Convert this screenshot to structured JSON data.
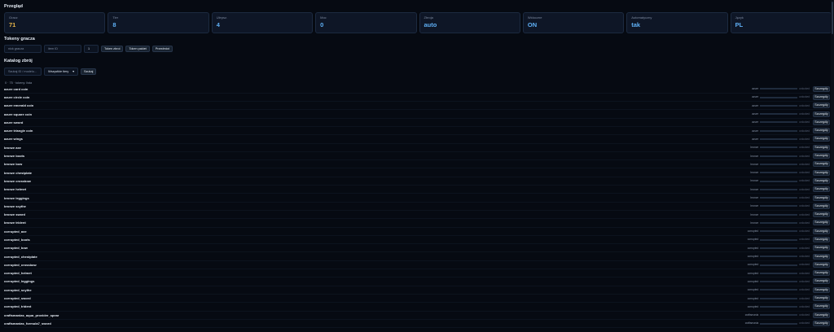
{
  "overview": {
    "title": "Przegląd",
    "cards": [
      {
        "label": "Gracz",
        "value": "71",
        "gold": true
      },
      {
        "label": "Tier",
        "value": "8"
      },
      {
        "label": "Ulepsz.",
        "value": "4"
      },
      {
        "label": "Moc",
        "value": "0"
      },
      {
        "label": "Zbroja",
        "value": "auto"
      },
      {
        "label": "Widoczne",
        "value": "ON"
      },
      {
        "label": "Automatyczny",
        "value": "tak"
      },
      {
        "label": "Język",
        "value": "PL"
      }
    ]
  },
  "tokens": {
    "title": "Tokeny gracza",
    "player_placeholder": "nick gracza",
    "item_placeholder": "item ID",
    "amount_value": "1",
    "buttons": [
      "Token zbroi",
      "Token pakiet",
      "Przedmiot"
    ]
  },
  "catalog": {
    "title": "Katalog zbrój",
    "search_placeholder": "Szukaj ID / modelu...",
    "filter_value": "Wszystkie tiery",
    "filter_chevron": "▾",
    "filter_button": "Szukaj",
    "meta_text": "0 · 75 · tokeny: lista",
    "give_label": "Szczegóły",
    "items": [
      {
        "name": "azure card coin",
        "tier": "azure"
      },
      {
        "name": "azure circle coin",
        "tier": "azure"
      },
      {
        "name": "azure emerald coin",
        "tier": "azure"
      },
      {
        "name": "azure square coin",
        "tier": "azure"
      },
      {
        "name": "azure sword",
        "tier": "azure"
      },
      {
        "name": "azure triangle coin",
        "tier": "azure"
      },
      {
        "name": "azure wings",
        "tier": "azure"
      },
      {
        "name": "bronze axe",
        "tier": "bronze"
      },
      {
        "name": "bronze boots",
        "tier": "bronze"
      },
      {
        "name": "bronze bow",
        "tier": "bronze"
      },
      {
        "name": "bronze chestplate",
        "tier": "bronze"
      },
      {
        "name": "bronze crossbow",
        "tier": "bronze"
      },
      {
        "name": "bronze helmet",
        "tier": "bronze"
      },
      {
        "name": "bronze leggings",
        "tier": "bronze"
      },
      {
        "name": "bronze scythe",
        "tier": "bronze"
      },
      {
        "name": "bronze sword",
        "tier": "bronze"
      },
      {
        "name": "bronze trident",
        "tier": "bronze"
      },
      {
        "name": "corrupted_axe",
        "tier": "corrupted"
      },
      {
        "name": "corrupted_boots",
        "tier": "corrupted"
      },
      {
        "name": "corrupted_bow",
        "tier": "corrupted"
      },
      {
        "name": "corrupted_chestplate",
        "tier": "corrupted"
      },
      {
        "name": "corrupted_crossbow",
        "tier": "corrupted"
      },
      {
        "name": "corrupted_helmet",
        "tier": "corrupted"
      },
      {
        "name": "corrupted_leggings",
        "tier": "corrupted"
      },
      {
        "name": "corrupted_scythe",
        "tier": "corrupted"
      },
      {
        "name": "corrupted_sword",
        "tier": "corrupted"
      },
      {
        "name": "corrupted_trident",
        "tier": "corrupted"
      },
      {
        "name": "craftsmanias_aqua_provider_spear",
        "tier": "craftsmania"
      },
      {
        "name": "craftsmanias_formula7_sword",
        "tier": "craftsmania"
      }
    ],
    "unlocked_label": "unlocked"
  }
}
